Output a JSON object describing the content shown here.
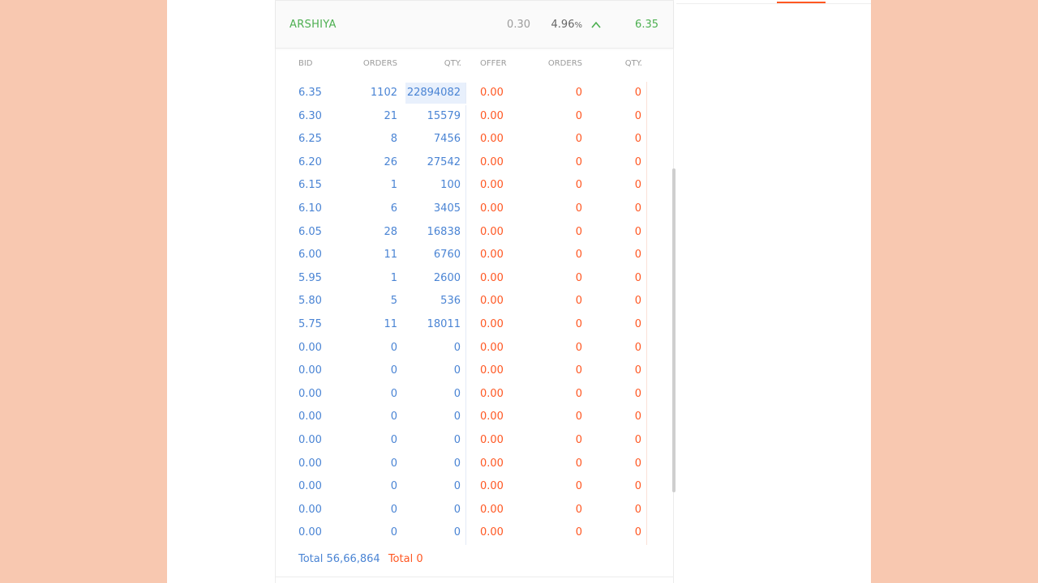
{
  "instrument": {
    "symbol": "ARSHIYA",
    "change": "0.30",
    "change_pct": "4.96",
    "pct_sign": "%",
    "direction_icon": "chevron-up-icon",
    "ltp": "6.35"
  },
  "depth": {
    "columns": {
      "bid": "BID",
      "bid_orders": "ORDERS",
      "bid_qty": "QTY.",
      "offer": "OFFER",
      "offer_orders": "ORDERS",
      "offer_qty": "QTY."
    },
    "rows": [
      {
        "bid": "6.35",
        "bid_orders": "1102",
        "bid_qty": "22894082",
        "offer": "0.00",
        "offer_orders": "0",
        "offer_qty": "0"
      },
      {
        "bid": "6.30",
        "bid_orders": "21",
        "bid_qty": "15579",
        "offer": "0.00",
        "offer_orders": "0",
        "offer_qty": "0"
      },
      {
        "bid": "6.25",
        "bid_orders": "8",
        "bid_qty": "7456",
        "offer": "0.00",
        "offer_orders": "0",
        "offer_qty": "0"
      },
      {
        "bid": "6.20",
        "bid_orders": "26",
        "bid_qty": "27542",
        "offer": "0.00",
        "offer_orders": "0",
        "offer_qty": "0"
      },
      {
        "bid": "6.15",
        "bid_orders": "1",
        "bid_qty": "100",
        "offer": "0.00",
        "offer_orders": "0",
        "offer_qty": "0"
      },
      {
        "bid": "6.10",
        "bid_orders": "6",
        "bid_qty": "3405",
        "offer": "0.00",
        "offer_orders": "0",
        "offer_qty": "0"
      },
      {
        "bid": "6.05",
        "bid_orders": "28",
        "bid_qty": "16838",
        "offer": "0.00",
        "offer_orders": "0",
        "offer_qty": "0"
      },
      {
        "bid": "6.00",
        "bid_orders": "11",
        "bid_qty": "6760",
        "offer": "0.00",
        "offer_orders": "0",
        "offer_qty": "0"
      },
      {
        "bid": "5.95",
        "bid_orders": "1",
        "bid_qty": "2600",
        "offer": "0.00",
        "offer_orders": "0",
        "offer_qty": "0"
      },
      {
        "bid": "5.80",
        "bid_orders": "5",
        "bid_qty": "536",
        "offer": "0.00",
        "offer_orders": "0",
        "offer_qty": "0"
      },
      {
        "bid": "5.75",
        "bid_orders": "11",
        "bid_qty": "18011",
        "offer": "0.00",
        "offer_orders": "0",
        "offer_qty": "0"
      },
      {
        "bid": "0.00",
        "bid_orders": "0",
        "bid_qty": "0",
        "offer": "0.00",
        "offer_orders": "0",
        "offer_qty": "0"
      },
      {
        "bid": "0.00",
        "bid_orders": "0",
        "bid_qty": "0",
        "offer": "0.00",
        "offer_orders": "0",
        "offer_qty": "0"
      },
      {
        "bid": "0.00",
        "bid_orders": "0",
        "bid_qty": "0",
        "offer": "0.00",
        "offer_orders": "0",
        "offer_qty": "0"
      },
      {
        "bid": "0.00",
        "bid_orders": "0",
        "bid_qty": "0",
        "offer": "0.00",
        "offer_orders": "0",
        "offer_qty": "0"
      },
      {
        "bid": "0.00",
        "bid_orders": "0",
        "bid_qty": "0",
        "offer": "0.00",
        "offer_orders": "0",
        "offer_qty": "0"
      },
      {
        "bid": "0.00",
        "bid_orders": "0",
        "bid_qty": "0",
        "offer": "0.00",
        "offer_orders": "0",
        "offer_qty": "0"
      },
      {
        "bid": "0.00",
        "bid_orders": "0",
        "bid_qty": "0",
        "offer": "0.00",
        "offer_orders": "0",
        "offer_qty": "0"
      },
      {
        "bid": "0.00",
        "bid_orders": "0",
        "bid_qty": "0",
        "offer": "0.00",
        "offer_orders": "0",
        "offer_qty": "0"
      },
      {
        "bid": "0.00",
        "bid_orders": "0",
        "bid_qty": "0",
        "offer": "0.00",
        "offer_orders": "0",
        "offer_qty": "0"
      }
    ],
    "total": {
      "bid_label": "Total",
      "bid_qty": "56,66,864",
      "offer_label": "Total",
      "offer_qty": "0"
    }
  },
  "colors": {
    "positive": "#4caf50",
    "bid": "#4a84d4",
    "offer": "#ff5722",
    "accent": "#ff5722",
    "background": "#f8c8b0"
  }
}
